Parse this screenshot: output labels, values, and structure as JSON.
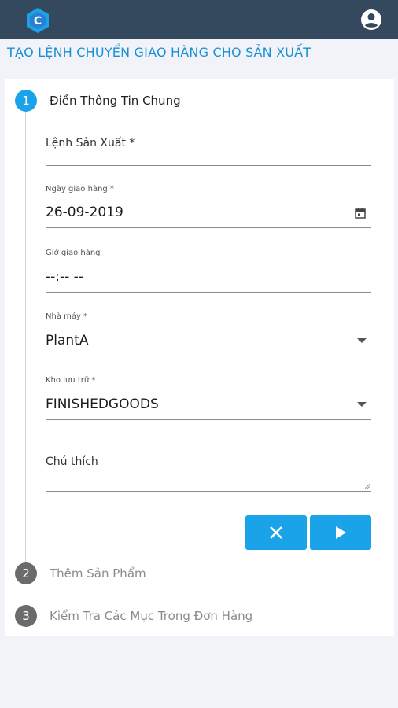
{
  "colors": {
    "header_bg": "#34495e",
    "accent": "#1aa3e8",
    "title": "#1a8fd8",
    "inactive_step": "#6b6b6b"
  },
  "header": {
    "logo_icon": "c-hexagon-icon",
    "account_icon": "account-circle-icon"
  },
  "page_title": "TẠO LỆNH CHUYỂN GIAO HÀNG CHO SẢN XUẤT",
  "steps": [
    {
      "number": "1",
      "label": "Điền Thông Tin Chung",
      "state": "active"
    },
    {
      "number": "2",
      "label": "Thêm Sản Phẩm",
      "state": "inactive"
    },
    {
      "number": "3",
      "label": "Kiểm Tra Các Mục Trong Đơn Hàng",
      "state": "inactive"
    }
  ],
  "form": {
    "production_order": {
      "label": "Lệnh Sản Xuất *",
      "value": ""
    },
    "delivery_date": {
      "label": "Ngày giao hàng *",
      "value": "26-09-2019",
      "icon": "calendar-icon"
    },
    "delivery_time": {
      "label": "Giờ giao hàng",
      "value": "--:-- --"
    },
    "plant": {
      "label": "Nhà máy *",
      "value": "PlantA",
      "icon": "dropdown-arrow-icon"
    },
    "storage": {
      "label": "Kho lưu trữ *",
      "value": "FINISHEDGOODS",
      "icon": "dropdown-arrow-icon"
    },
    "note": {
      "label": "Chú thích",
      "value": ""
    }
  },
  "actions": {
    "cancel_icon": "close-icon",
    "next_icon": "play-arrow-icon"
  }
}
